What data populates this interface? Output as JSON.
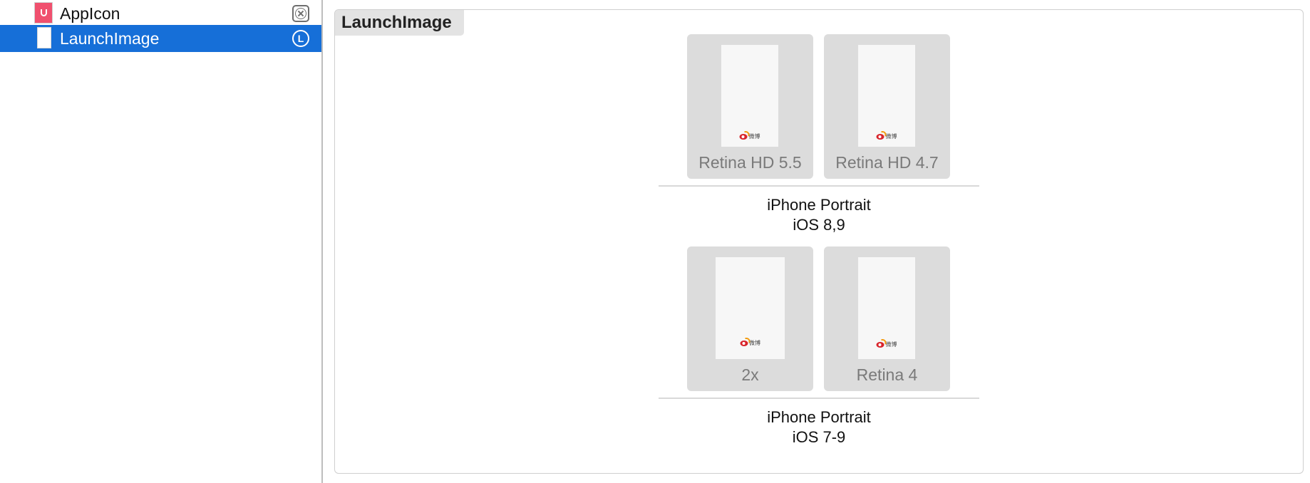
{
  "sidebar": {
    "items": [
      {
        "label": "AppIcon",
        "icon": "app-icon-thumbnail",
        "badge_icon": "no-image-icon",
        "selected": false
      },
      {
        "label": "LaunchImage",
        "icon": "launch-image-thumbnail",
        "badge_icon": "launch-badge-icon",
        "badge_text": "L",
        "selected": true
      }
    ]
  },
  "main": {
    "title": "LaunchImage",
    "groups": [
      {
        "slots": [
          {
            "label": "Retina HD 5.5",
            "logo_text": "微博"
          },
          {
            "label": "Retina HD 4.7",
            "logo_text": "微博"
          }
        ],
        "name_line1": "iPhone Portrait",
        "name_line2": "iOS 8,9"
      },
      {
        "slots": [
          {
            "label": "2x",
            "logo_text": "微博"
          },
          {
            "label": "Retina 4",
            "logo_text": "微博"
          }
        ],
        "name_line1": "iPhone Portrait",
        "name_line2": "iOS 7-9"
      }
    ]
  },
  "colors": {
    "selection": "#166fd8",
    "slot_background": "#dcdcdc",
    "slot_label": "#7a7a7a",
    "logo_red": "#d8252c"
  }
}
